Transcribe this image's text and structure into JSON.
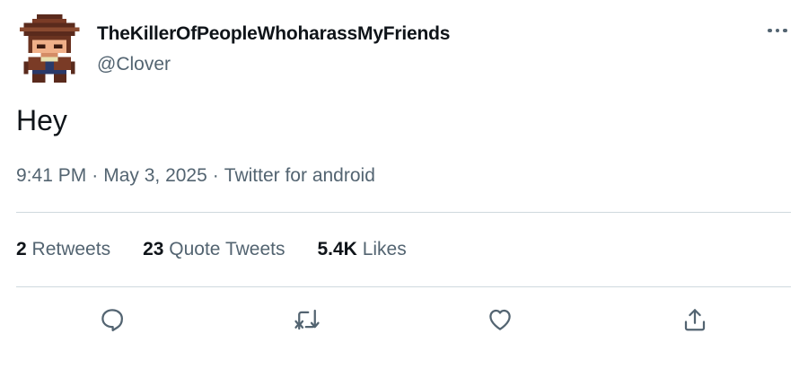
{
  "tweet": {
    "author": {
      "display_name": "TheKillerOfPeopleWhoharassMyFriends",
      "handle": "@Clover",
      "avatar_icon": "pixel-art-cowboy-avatar"
    },
    "text": "Hey",
    "meta": {
      "time": "9:41 PM",
      "separator": "·",
      "date": "May 3, 2025",
      "source": "Twitter for android"
    },
    "stats": {
      "retweets_count": "2",
      "retweets_label": "Retweets",
      "quotes_count": "23",
      "quotes_label": "Quote Tweets",
      "likes_count": "5.4K",
      "likes_label": "Likes"
    },
    "actions": [
      {
        "icon": "reply-icon"
      },
      {
        "icon": "retweet-icon"
      },
      {
        "icon": "like-icon"
      },
      {
        "icon": "share-icon"
      }
    ]
  },
  "colors": {
    "text_primary": "#0f1419",
    "text_secondary": "#536471",
    "divider": "#cfd9de"
  }
}
